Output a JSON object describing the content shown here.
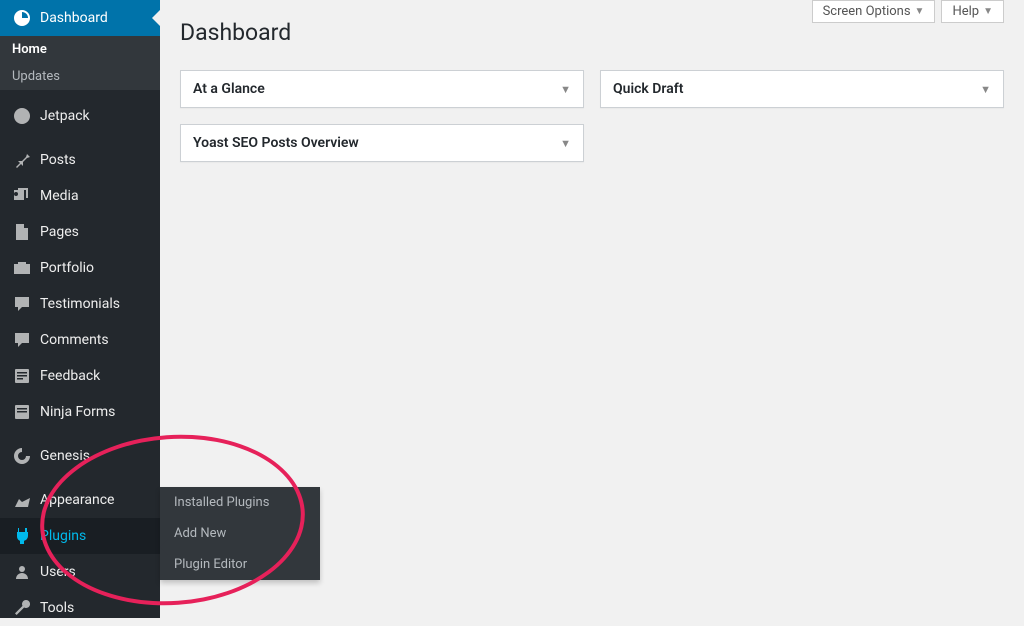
{
  "sidebar": {
    "dashboard": {
      "label": "Dashboard"
    },
    "sub": {
      "home": "Home",
      "updates": "Updates"
    },
    "items": [
      {
        "label": "Jetpack"
      },
      {
        "label": "Posts"
      },
      {
        "label": "Media"
      },
      {
        "label": "Pages"
      },
      {
        "label": "Portfolio"
      },
      {
        "label": "Testimonials"
      },
      {
        "label": "Comments"
      },
      {
        "label": "Feedback"
      },
      {
        "label": "Ninja Forms"
      },
      {
        "label": "Genesis"
      },
      {
        "label": "Appearance"
      },
      {
        "label": "Plugins"
      },
      {
        "label": "Users"
      },
      {
        "label": "Tools"
      }
    ]
  },
  "flyout": {
    "items": [
      "Installed Plugins",
      "Add New",
      "Plugin Editor"
    ]
  },
  "top": {
    "screen_options": "Screen Options",
    "help": "Help"
  },
  "page_title": "Dashboard",
  "widgets": {
    "col1": [
      {
        "title": "At a Glance"
      },
      {
        "title": "Yoast SEO Posts Overview"
      }
    ],
    "col2": [
      {
        "title": "Quick Draft"
      }
    ]
  }
}
